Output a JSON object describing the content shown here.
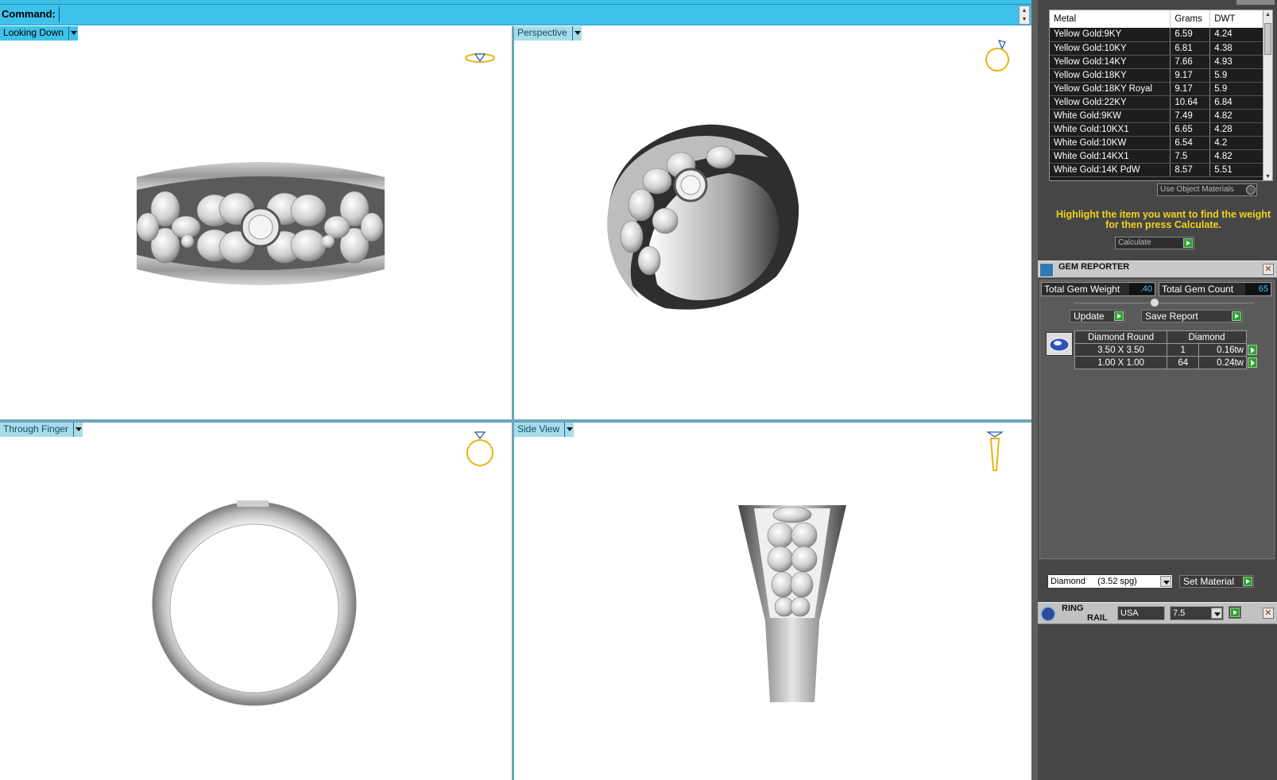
{
  "command": {
    "label": "Command:",
    "value": ""
  },
  "viewports": {
    "top_left": {
      "label": "Looking Down"
    },
    "top_right": {
      "label": "Perspective"
    },
    "bottom_left": {
      "label": "Through Finger"
    },
    "bottom_right": {
      "label": "Side View"
    }
  },
  "metal_table": {
    "headers": [
      "Metal",
      "Grams",
      "DWT"
    ],
    "rows": [
      [
        "Yellow Gold:9KY",
        "6.59",
        "4.24"
      ],
      [
        "Yellow Gold:10KY",
        "6.81",
        "4.38"
      ],
      [
        "Yellow Gold:14KY",
        "7.66",
        "4.93"
      ],
      [
        "Yellow Gold:18KY",
        "9.17",
        "5.9"
      ],
      [
        "Yellow Gold:18KY Royal",
        "9.17",
        "5.9"
      ],
      [
        "Yellow Gold:22KY",
        "10.64",
        "6.84"
      ],
      [
        "White Gold:9KW",
        "7.49",
        "4.82"
      ],
      [
        "White Gold:10KX1",
        "6.65",
        "4.28"
      ],
      [
        "White Gold:10KW",
        "6.54",
        "4.2"
      ],
      [
        "White Gold:14KX1",
        "7.5",
        "4.82"
      ],
      [
        "White Gold:14K PdW",
        "8.57",
        "5.51"
      ]
    ]
  },
  "use_object_materials_label": "Use Object Materials",
  "hint": "Highlight the item you want to find the weight for then press Calculate.",
  "calculate_label": "Calculate",
  "gem_reporter": {
    "title": "GEM REPORTER",
    "total_weight_label": "Total Gem Weight",
    "total_weight_value": ".40",
    "total_count_label": "Total Gem Count",
    "total_count_value": "65",
    "update_label": "Update",
    "save_report_label": "Save Report",
    "table": {
      "headers": [
        "Diamond Round",
        "Diamond"
      ],
      "rows": [
        {
          "size": "3.50 X 3.50",
          "count": "1",
          "weight": "0.16tw"
        },
        {
          "size": "1.00 X 1.00",
          "count": "64",
          "weight": "0.24tw"
        }
      ]
    },
    "material_select": "Diamond     (3.52 spg)",
    "set_material_label": "Set Material"
  },
  "ring_rail": {
    "title_line1": "RING",
    "title_line2": "RAIL",
    "region": "USA",
    "size": "7.5"
  },
  "colors": {
    "accent": "#3ec2ea",
    "panel_bg": "#464646",
    "hint_text": "#f2d21a",
    "value_text": "#4ac2ff",
    "go_button": "#30a030"
  }
}
